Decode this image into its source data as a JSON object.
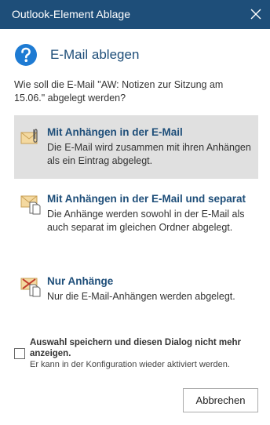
{
  "window": {
    "title": "Outlook-Element Ablage",
    "close_icon": "close-icon"
  },
  "header": {
    "icon": "help-icon",
    "title": "E-Mail ablegen"
  },
  "question": "Wie soll die E-Mail \"AW: Notizen zur Sitzung am 15.06.\" abgelegt werden?",
  "options": [
    {
      "icon": "mail-with-attachment-icon",
      "title": "Mit Anhängen in der E-Mail",
      "description": "Die E-Mail wird zusammen mit ihren Anhängen als ein Eintrag abgelegt.",
      "selected": true
    },
    {
      "icon": "mail-and-documents-icon",
      "title": "Mit Anhängen in der E-Mail und separat",
      "description": "Die Anhänge werden sowohl in der E-Mail als auch separat im gleichen Ordner abgelegt.",
      "selected": false
    },
    {
      "icon": "attachments-only-icon",
      "title": "Nur Anhänge",
      "description": "Nur die E-Mail-Anhängen werden abgelegt.",
      "selected": false
    }
  ],
  "remember": {
    "label": "Auswahl speichern und diesen Dialog nicht mehr anzeigen.",
    "hint": "Er kann in der Konfiguration wieder aktiviert werden.",
    "checked": false
  },
  "buttons": {
    "cancel": "Abbrechen"
  },
  "colors": {
    "titlebar": "#1e4e79",
    "accent": "#1e4e79",
    "selected_bg": "#e0e0e0"
  }
}
